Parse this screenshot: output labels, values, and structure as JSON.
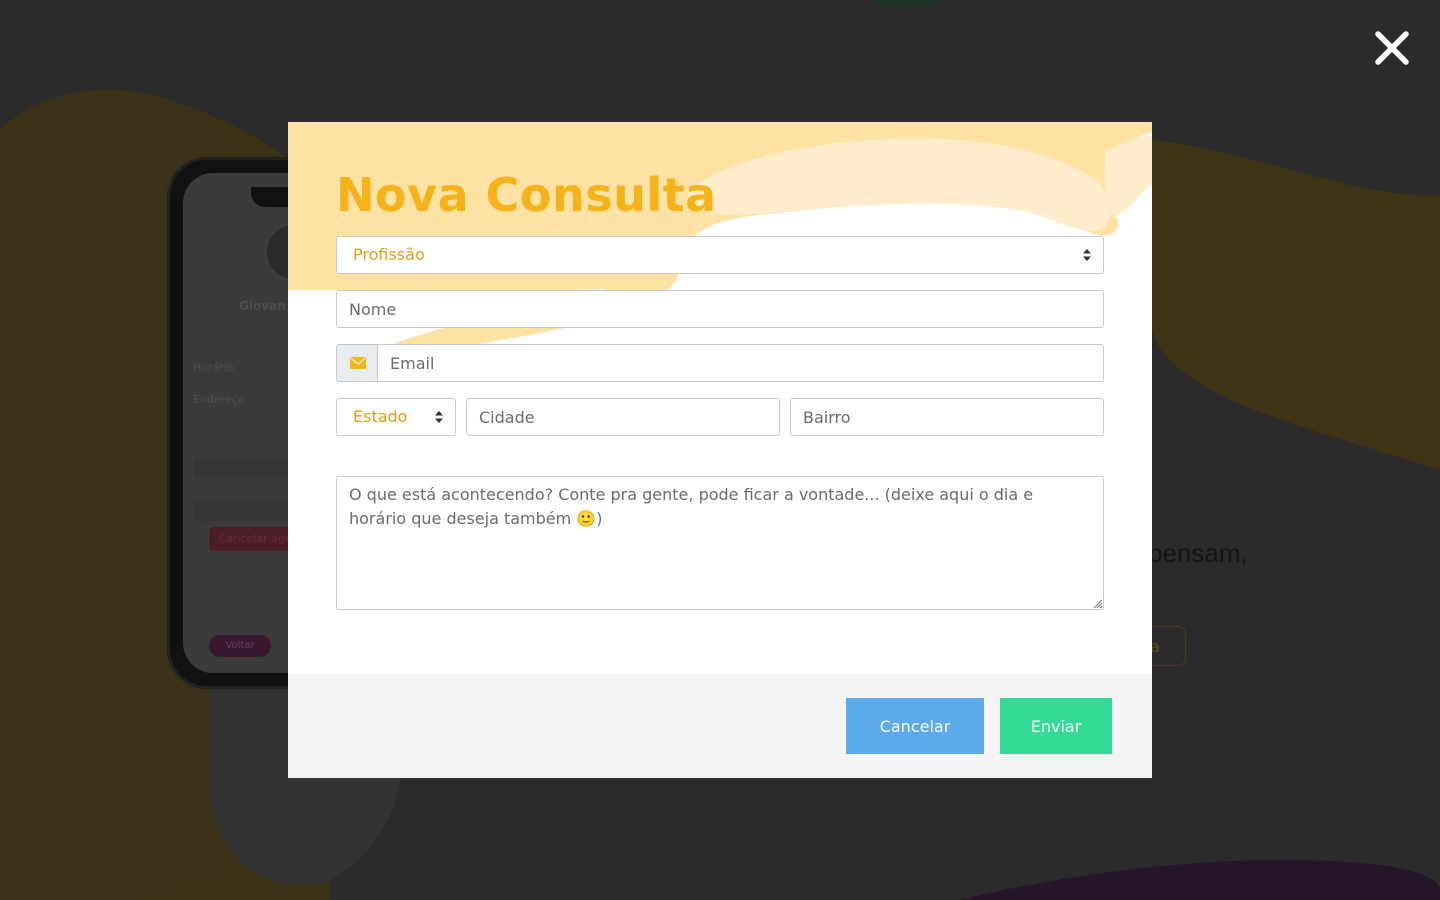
{
  "colors": {
    "accent": "#f6b217",
    "select_text": "#e79d0c",
    "cancel_button": "#5caaec",
    "send_button": "#33dc96",
    "overlay": "#2b2b2b"
  },
  "background": {
    "phone": {
      "name": "Giovan",
      "rows": [
        "Horário",
        "Endereço"
      ],
      "cancel_label": "Cancelar agenda",
      "back_label": "Voltar"
    },
    "headline_fragment": "pensam,",
    "button_fragment": "ta"
  },
  "close_icon": "close-icon",
  "modal": {
    "title": "Nova Consulta",
    "profession_select": {
      "value": "Profissão"
    },
    "name_field": {
      "placeholder": "Nome"
    },
    "email_field": {
      "placeholder": "Email",
      "icon": "envelope-icon"
    },
    "state_select": {
      "value": "Estado"
    },
    "city_field": {
      "placeholder": "Cidade"
    },
    "neighborhood_field": {
      "placeholder": "Bairro"
    },
    "message_field": {
      "placeholder": "O que está acontecendo? Conte pra gente, pode ficar a vontade... (deixe aqui o dia e horário que deseja também 🙂)"
    },
    "footer": {
      "cancel_label": "Cancelar",
      "send_label": "Enviar"
    }
  }
}
